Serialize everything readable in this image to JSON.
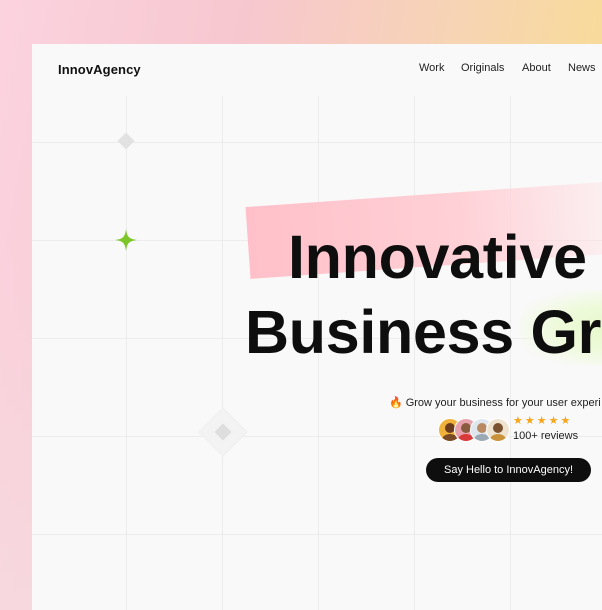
{
  "brand": {
    "name": "InnovAgency"
  },
  "nav": {
    "items": [
      "Work",
      "Originals",
      "About",
      "News"
    ]
  },
  "hero": {
    "headline_line1": "Innovative",
    "headline_line2": "Business Gr",
    "tagline": "Grow your business for your user experi",
    "rating": {
      "stars": "★★★★★",
      "reviews_text": "100+ reviews"
    },
    "cta_label": "Say Hello to InnovAgency!"
  },
  "icons": {
    "fire": "fire-icon",
    "sparkle": "sparkle-icon",
    "diamond": "diamond-icon",
    "star": "star-icon"
  },
  "colors": {
    "accent_green": "#7cc62a",
    "highlight_pink": "#ffc0c9",
    "highlight_green": "#e6f8c8",
    "star_orange": "#f6a51c",
    "cta_bg": "#0e0e0e"
  }
}
